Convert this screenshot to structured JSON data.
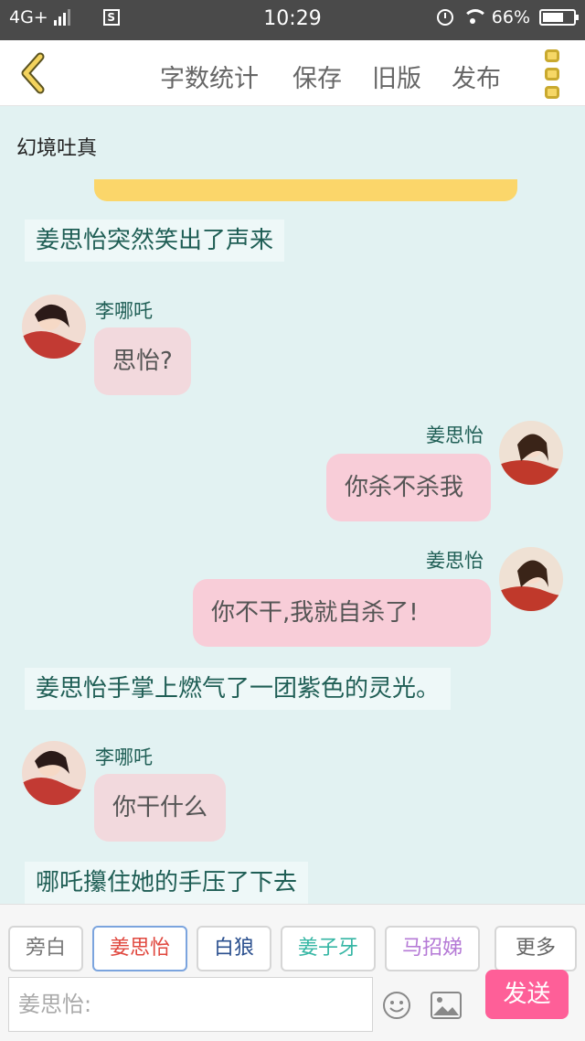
{
  "status_bar": {
    "network": "4G+",
    "time": "10:29",
    "battery": "66%"
  },
  "toolbar": {
    "items": [
      "字数统计",
      "保存",
      "旧版",
      "发布"
    ]
  },
  "scene_title": "幻境吐真",
  "messages": {
    "narr1": "姜思怡突然笑出了声来",
    "m1_name": "李哪吒",
    "m1_text": "思怡?",
    "m2_name": "姜思怡",
    "m2_text": "你杀不杀我",
    "m3_name": "姜思怡",
    "m3_text": "你不干,我就自杀了!",
    "narr2": "姜思怡手掌上燃气了一团紫色的灵光。",
    "m4_name": "李哪吒",
    "m4_text": "你干什么",
    "narr3": "哪吒攥住她的手压了下去"
  },
  "roles": [
    {
      "label": "旁白",
      "color": "#777777"
    },
    {
      "label": "姜思怡",
      "color": "#e0473e"
    },
    {
      "label": "白狼",
      "color": "#2a4f8e"
    },
    {
      "label": "姜子牙",
      "color": "#35b6a4"
    },
    {
      "label": "马招娣",
      "color": "#b57ad6"
    },
    {
      "label": "更多",
      "color": "#666666"
    }
  ],
  "input": {
    "placeholder": "姜思怡:"
  },
  "send_label": "发送",
  "colors": {
    "accent": "#fe5f98",
    "chat_bg": "#e2f2f2",
    "bubble": "#f2d9dd",
    "highlight": "#fbd66a"
  }
}
